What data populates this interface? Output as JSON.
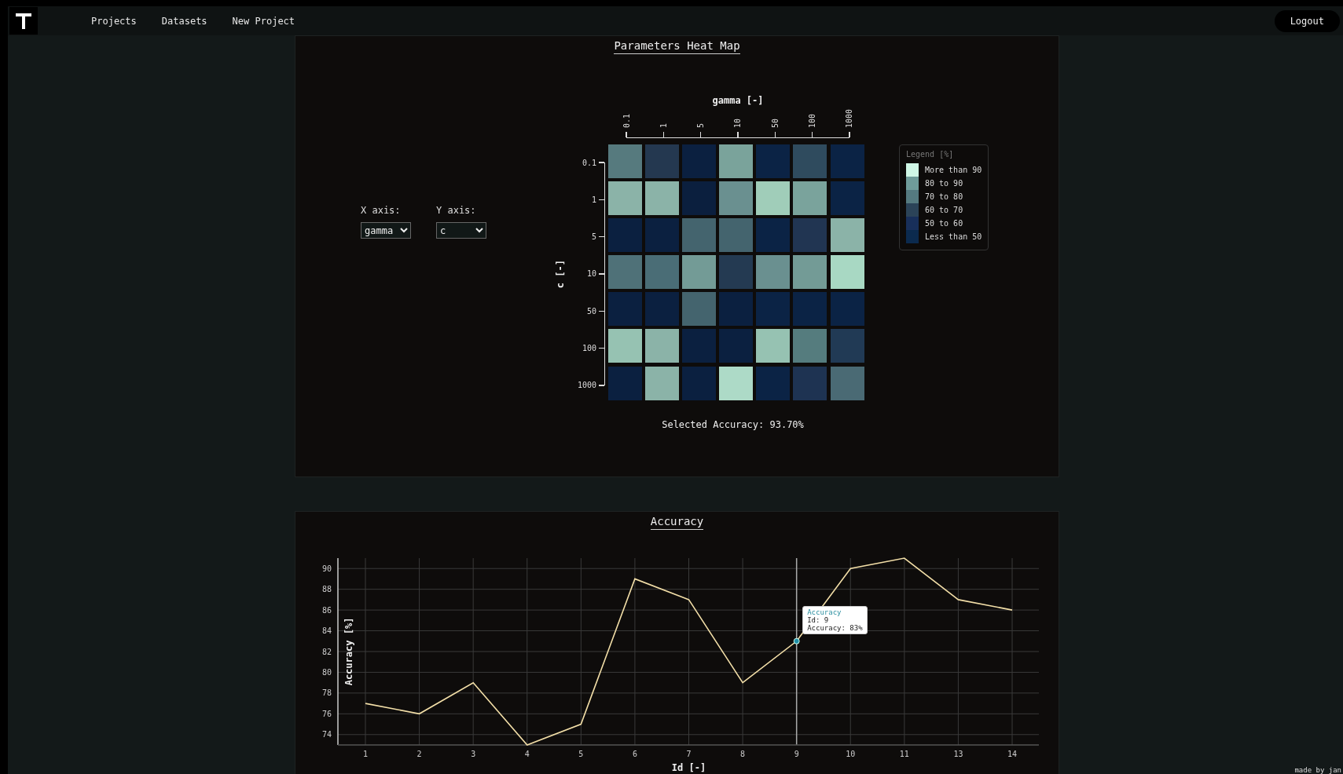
{
  "nav": {
    "links": [
      {
        "label": "Projects"
      },
      {
        "label": "Datasets"
      },
      {
        "label": "New Project"
      }
    ],
    "logout": "Logout"
  },
  "heatmap_panel": {
    "title": "Parameters Heat Map",
    "x_axis_control": {
      "label": "X axis:",
      "value": "gamma"
    },
    "y_axis_control": {
      "label": "Y axis:",
      "value": "c"
    },
    "x_title": "gamma [-]",
    "y_title": "c [-]",
    "columns": [
      "0.1",
      "1",
      "5",
      "10",
      "50",
      "100",
      "1000"
    ],
    "rows": [
      {
        "label": "0.1",
        "cells": [
          {
            "color": "#567a7e"
          },
          {
            "color": "#243850"
          },
          {
            "color": "#0b2040"
          },
          {
            "color": "#7aa39b"
          },
          {
            "color": "#0b2345"
          },
          {
            "color": "#2f4b5e"
          },
          {
            "color": "#0b2345"
          }
        ]
      },
      {
        "label": "1",
        "cells": [
          {
            "color": "#8bb3a8"
          },
          {
            "color": "#8bb3a8"
          },
          {
            "color": "#0b1f3e"
          },
          {
            "color": "#6a9090"
          },
          {
            "color": "#a0cdb9"
          },
          {
            "color": "#7aa39c"
          },
          {
            "color": "#0b2345"
          }
        ]
      },
      {
        "label": "5",
        "cells": [
          {
            "color": "#0b2040"
          },
          {
            "color": "#0b2040"
          },
          {
            "color": "#44646e"
          },
          {
            "color": "#44646e"
          },
          {
            "color": "#0b2345"
          },
          {
            "color": "#213552"
          },
          {
            "color": "#8bb3a8"
          }
        ]
      },
      {
        "label": "10",
        "cells": [
          {
            "color": "#4f7178"
          },
          {
            "color": "#4a6d76"
          },
          {
            "color": "#739b96"
          },
          {
            "color": "#243a52"
          },
          {
            "color": "#6a9090"
          },
          {
            "color": "#739b96"
          },
          {
            "color": "#a8d8c3"
          }
        ]
      },
      {
        "label": "50",
        "cells": [
          {
            "color": "#0b2040"
          },
          {
            "color": "#0b2040"
          },
          {
            "color": "#44646e"
          },
          {
            "color": "#0b2040"
          },
          {
            "color": "#0b2345"
          },
          {
            "color": "#0b2345"
          },
          {
            "color": "#0b2345"
          }
        ]
      },
      {
        "label": "100",
        "cells": [
          {
            "color": "#96c2b2"
          },
          {
            "color": "#8bb3a8"
          },
          {
            "color": "#0b2040"
          },
          {
            "color": "#0b2040"
          },
          {
            "color": "#96c2b2"
          },
          {
            "color": "#557c7e"
          },
          {
            "color": "#213a55"
          }
        ]
      },
      {
        "label": "1000",
        "cells": [
          {
            "color": "#0b2040"
          },
          {
            "color": "#8bb3a8"
          },
          {
            "color": "#0b2040"
          },
          {
            "color": "#addac7"
          },
          {
            "color": "#0b2345"
          },
          {
            "color": "#1e3352"
          },
          {
            "color": "#4a6a74"
          }
        ]
      }
    ],
    "legend": {
      "title": "Legend [%]",
      "items": [
        {
          "label": "More than 90",
          "color": "#cff7e6"
        },
        {
          "label": "80 to 90",
          "color": "#6f9c9a"
        },
        {
          "label": "70 to 80",
          "color": "#557a80"
        },
        {
          "label": "60 to 70",
          "color": "#2b4358"
        },
        {
          "label": "50 to 60",
          "color": "#182f5a"
        },
        {
          "label": "Less than 50",
          "color": "#0b2a4e"
        }
      ]
    },
    "selected": "Selected Accuracy: 93.70%"
  },
  "accuracy_panel": {
    "title": "Accuracy",
    "chart_data": {
      "type": "line",
      "xlabel": "Id [-]",
      "ylabel": "Accuracy [%]",
      "categories": [
        "1",
        "2",
        "3",
        "4",
        "5",
        "6",
        "7",
        "8",
        "9",
        "10",
        "11",
        "13",
        "14"
      ],
      "series": [
        {
          "name": "Accuracy",
          "color": "#f3dfa8",
          "values": [
            77,
            76,
            79,
            73,
            75,
            89,
            87,
            79,
            83,
            90,
            91,
            87,
            86
          ]
        }
      ],
      "ylim": [
        73,
        91
      ],
      "yticks": [
        74,
        76,
        78,
        80,
        82,
        84,
        86,
        88,
        90
      ],
      "grid": true,
      "ref_lines": [
        {
          "axis": "x",
          "value": "9"
        }
      ],
      "annotations": [
        {
          "x": "9",
          "y": 83,
          "text": "Id: 9\nAccuracy: 83%"
        }
      ]
    }
  },
  "footer": "made by jan"
}
